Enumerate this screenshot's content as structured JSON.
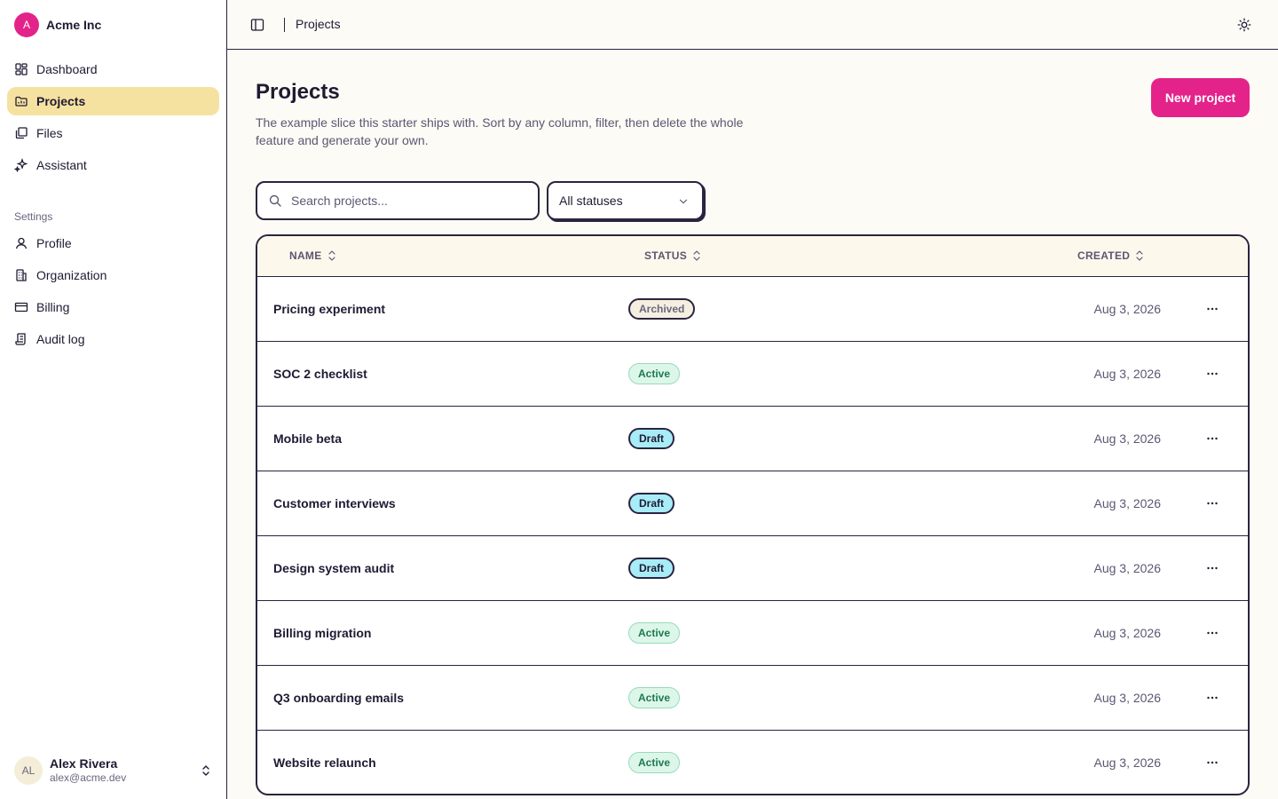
{
  "org": {
    "initial": "A",
    "name": "Acme Inc"
  },
  "sidebar": {
    "main_items": [
      {
        "label": "Dashboard",
        "icon": "dashboard-icon",
        "active": false
      },
      {
        "label": "Projects",
        "icon": "projects-icon",
        "active": true
      },
      {
        "label": "Files",
        "icon": "files-icon",
        "active": false
      },
      {
        "label": "Assistant",
        "icon": "sparkles-icon",
        "active": false
      }
    ],
    "settings_label": "Settings",
    "settings_items": [
      {
        "label": "Profile",
        "icon": "user-icon"
      },
      {
        "label": "Organization",
        "icon": "building-icon"
      },
      {
        "label": "Billing",
        "icon": "credit-card-icon"
      },
      {
        "label": "Audit log",
        "icon": "scroll-icon"
      }
    ]
  },
  "user": {
    "initials": "AL",
    "name": "Alex Rivera",
    "email": "alex@acme.dev"
  },
  "topbar": {
    "breadcrumb": "Projects"
  },
  "page": {
    "title": "Projects",
    "description": "The example slice this starter ships with. Sort by any column, filter, then delete the whole feature and generate your own.",
    "new_button": "New project"
  },
  "filters": {
    "search_placeholder": "Search projects...",
    "status_value": "All statuses"
  },
  "table": {
    "columns": {
      "name": "NAME",
      "status": "STATUS",
      "created": "CREATED"
    },
    "rows": [
      {
        "name": "Pricing experiment",
        "status": "Archived",
        "created": "Aug 3, 2026"
      },
      {
        "name": "SOC 2 checklist",
        "status": "Active",
        "created": "Aug 3, 2026"
      },
      {
        "name": "Mobile beta",
        "status": "Draft",
        "created": "Aug 3, 2026"
      },
      {
        "name": "Customer interviews",
        "status": "Draft",
        "created": "Aug 3, 2026"
      },
      {
        "name": "Design system audit",
        "status": "Draft",
        "created": "Aug 3, 2026"
      },
      {
        "name": "Billing migration",
        "status": "Active",
        "created": "Aug 3, 2026"
      },
      {
        "name": "Q3 onboarding emails",
        "status": "Active",
        "created": "Aug 3, 2026"
      },
      {
        "name": "Website relaunch",
        "status": "Active",
        "created": "Aug 3, 2026"
      }
    ]
  },
  "colors": {
    "accent": "#e3238a",
    "active_nav": "#f6e2a0",
    "border": "#2a2440"
  }
}
